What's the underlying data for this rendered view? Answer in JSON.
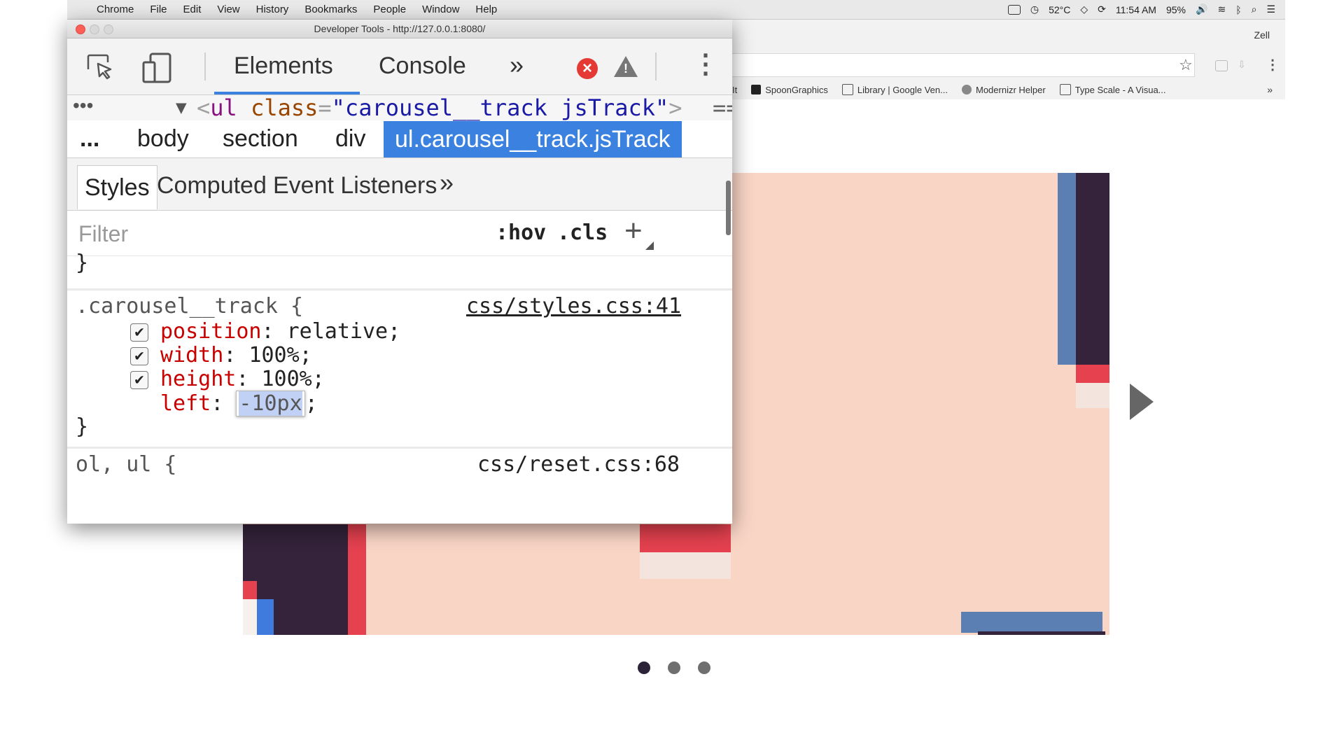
{
  "menubar": {
    "items": [
      "Chrome",
      "File",
      "Edit",
      "View",
      "History",
      "Bookmarks",
      "People",
      "Window",
      "Help"
    ],
    "battery_temp": "52°C",
    "clock": "11:54 AM",
    "battery": "95%"
  },
  "browser": {
    "profile_name": "Zell",
    "bookmarks": [
      "It",
      "SpoonGraphics",
      "Library | Google Ven...",
      "Modernizr Helper",
      "Type Scale - A Visua..."
    ],
    "bookmarks_more": "»"
  },
  "devtools": {
    "window_title": "Developer Tools - http://127.0.0.1:8080/",
    "tabs": {
      "elements": "Elements",
      "console": "Console",
      "more": "»"
    },
    "dom": {
      "dots": "•••",
      "arrow": "▼",
      "open": "<",
      "tag": "ul",
      "attr": "class",
      "eq": "=",
      "value": "\"carousel__track jsTrack\"",
      "close": ">",
      "trail": "=="
    },
    "breadcrumbs": {
      "ellipsis": "...",
      "items": [
        "body",
        "section",
        "div"
      ],
      "active": "ul.carousel__track.jsTrack"
    },
    "sidebar_tabs": {
      "styles": "Styles",
      "computed": "Computed",
      "event_listeners": "Event Listeners",
      "more": "»"
    },
    "filter": {
      "placeholder": "Filter",
      "hov": ":hov",
      "cls": ".cls",
      "add": "+"
    },
    "styles": {
      "prev_rule_close": "}",
      "rule1": {
        "selector": ".carousel__track {",
        "source": "css/styles.css:41",
        "declarations": [
          {
            "checked": true,
            "property": "position",
            "value": "relative;"
          },
          {
            "checked": true,
            "property": "width",
            "value": "100%;"
          },
          {
            "checked": true,
            "property": "height",
            "value": "100%;"
          },
          {
            "checked": false,
            "property": "left",
            "value": "-10px"
          }
        ],
        "close": "}"
      },
      "rule2": {
        "selector": "ol, ul {",
        "source": "css/reset.css:68"
      }
    }
  },
  "carousel": {
    "colors": {
      "peach": "#f9d5c6",
      "blue": "#5b7fb3",
      "dark": "#34233a",
      "red": "#e5414f"
    },
    "dots": [
      {
        "active": true
      },
      {
        "active": false
      },
      {
        "active": false
      }
    ]
  }
}
